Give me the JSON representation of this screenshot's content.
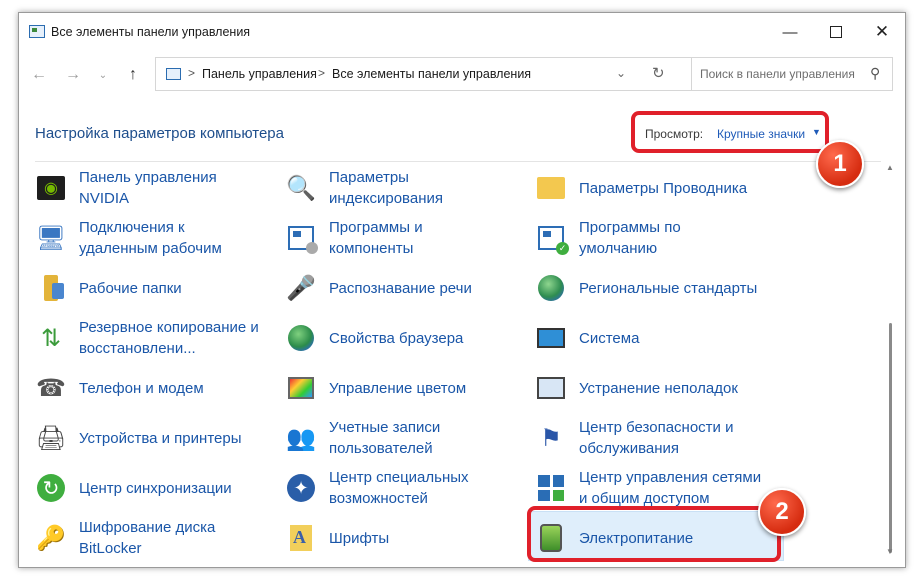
{
  "window": {
    "title": "Все элементы панели управления",
    "minimize_icon": "minimize-icon",
    "maximize_icon": "maximize-icon",
    "close_icon": "close-icon"
  },
  "nav": {
    "back_icon": "arrow-left-icon",
    "forward_icon": "arrow-right-icon",
    "history_icon": "chevron-down-icon",
    "up_icon": "arrow-up-icon"
  },
  "address": {
    "crumbs": [
      "Панель управления",
      "Все элементы панели управления"
    ],
    "separator": ">"
  },
  "search": {
    "placeholder": "Поиск в панели управления"
  },
  "heading": "Настройка параметров компьютера",
  "view": {
    "label": "Просмотр:",
    "value": "Крупные значки"
  },
  "items": [
    {
      "label": "Панель управления\nNVIDIA",
      "icon": "nvidia-icon"
    },
    {
      "label": "Параметры\nиндексирования",
      "icon": "indexing-icon"
    },
    {
      "label": "Параметры Проводника",
      "icon": "folder-options-icon"
    },
    {
      "label": "Подключения к\nудаленным рабочим",
      "icon": "remote-desktop-icon"
    },
    {
      "label": "Программы и\nкомпоненты",
      "icon": "programs-icon"
    },
    {
      "label": "Программы по\nумолчанию",
      "icon": "default-programs-icon"
    },
    {
      "label": "Рабочие папки",
      "icon": "work-folders-icon"
    },
    {
      "label": "Распознавание речи",
      "icon": "microphone-icon"
    },
    {
      "label": "Региональные стандарты",
      "icon": "region-icon"
    },
    {
      "label": "Резервное копирование и\nвосстановлени...",
      "icon": "backup-icon"
    },
    {
      "label": "Свойства браузера",
      "icon": "internet-options-icon"
    },
    {
      "label": "Система",
      "icon": "system-icon"
    },
    {
      "label": "Телефон и модем",
      "icon": "phone-icon"
    },
    {
      "label": "Управление цветом",
      "icon": "color-management-icon"
    },
    {
      "label": "Устранение неполадок",
      "icon": "troubleshooting-icon"
    },
    {
      "label": "Устройства и принтеры",
      "icon": "printer-icon"
    },
    {
      "label": "Учетные записи\nпользователей",
      "icon": "user-accounts-icon"
    },
    {
      "label": "Центр безопасности и\nобслуживания",
      "icon": "security-flag-icon"
    },
    {
      "label": "Центр синхронизации",
      "icon": "sync-icon"
    },
    {
      "label": "Центр специальных\nвозможностей",
      "icon": "accessibility-icon"
    },
    {
      "label": "Центр управления сетями\nи общим доступом",
      "icon": "network-icon"
    },
    {
      "label": "Шифрование диска\nBitLocker",
      "icon": "bitlocker-icon"
    },
    {
      "label": "Шрифты",
      "icon": "fonts-icon"
    },
    {
      "label": "Электропитание",
      "icon": "power-icon"
    }
  ],
  "badges": [
    "1",
    "2"
  ],
  "colors": {
    "link": "#1a56a8",
    "heading": "#1e4e8c",
    "annotation_red": "#e0202a",
    "selected_bg": "#dfeefb"
  }
}
